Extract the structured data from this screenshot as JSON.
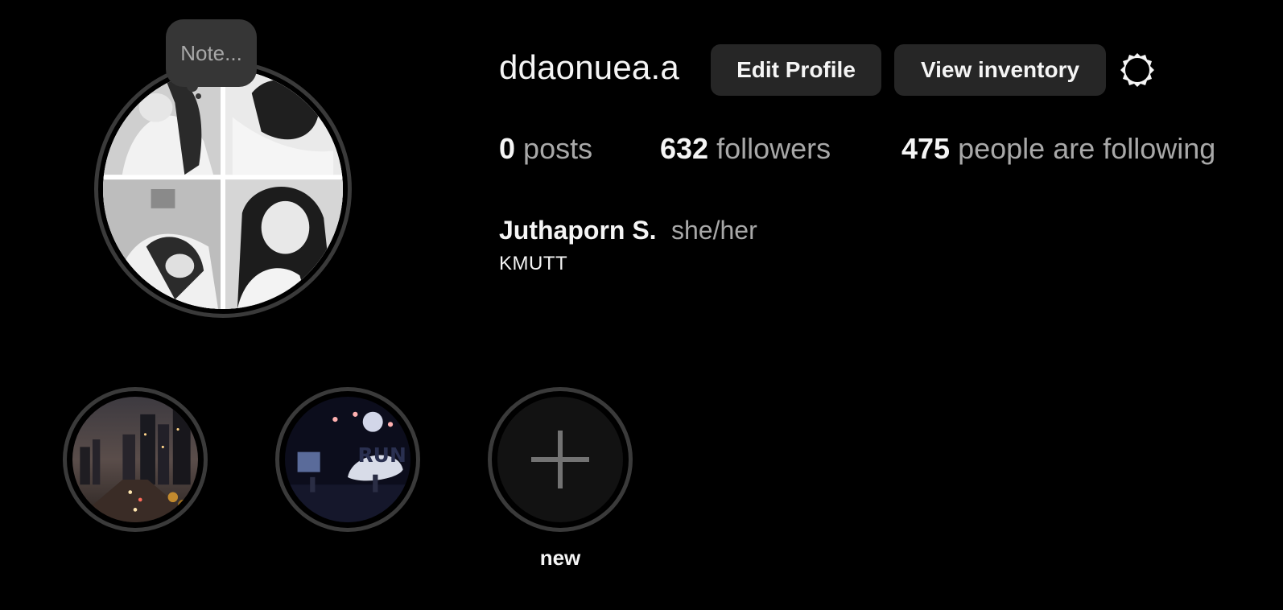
{
  "profile": {
    "username": "ddaonuea.a",
    "note_text": "Note...",
    "full_name": "Juthaporn S.",
    "pronouns": "she/her",
    "bio": "KMUTT"
  },
  "actions": {
    "edit_profile_label": "Edit Profile",
    "view_inventory_label": "View inventory"
  },
  "stats": {
    "posts_count": "0",
    "posts_label": "posts",
    "followers_count": "632",
    "followers_label": "followers",
    "following_count": "475",
    "following_label": "people are following"
  },
  "highlights": {
    "new_label": "new"
  },
  "icons": {
    "settings": "gear-icon",
    "add": "plus-icon"
  },
  "colors": {
    "background": "#000000",
    "button_bg": "#262626",
    "ring": "#3a3a3a",
    "muted_text": "#a8a8a8",
    "primary_text": "#f5f5f5"
  }
}
